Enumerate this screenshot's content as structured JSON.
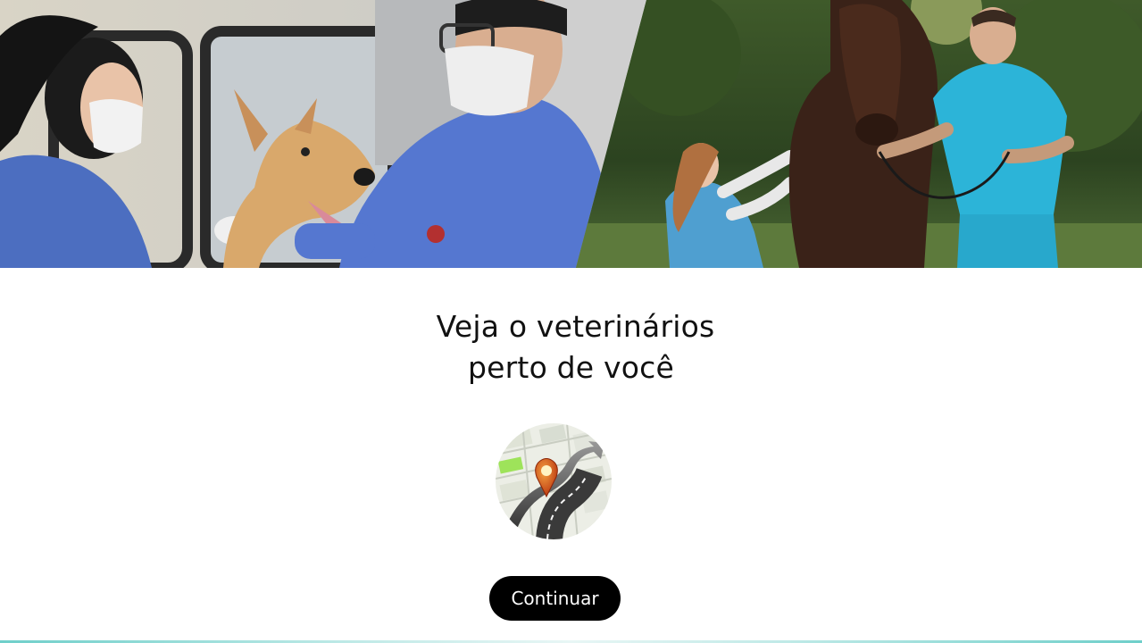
{
  "hero": {
    "left_scene": "vets-examining-dog",
    "right_scene": "vets-examining-horse"
  },
  "headline": {
    "line1": "Veja o veterinários",
    "line2": "perto de você"
  },
  "icon": {
    "name": "map-route-pin-icon"
  },
  "button": {
    "label": "Continuar"
  },
  "colors": {
    "button_bg": "#000000",
    "button_text": "#ffffff",
    "text": "#111111",
    "background": "#ffffff",
    "accent_line": "#6fcfca"
  }
}
